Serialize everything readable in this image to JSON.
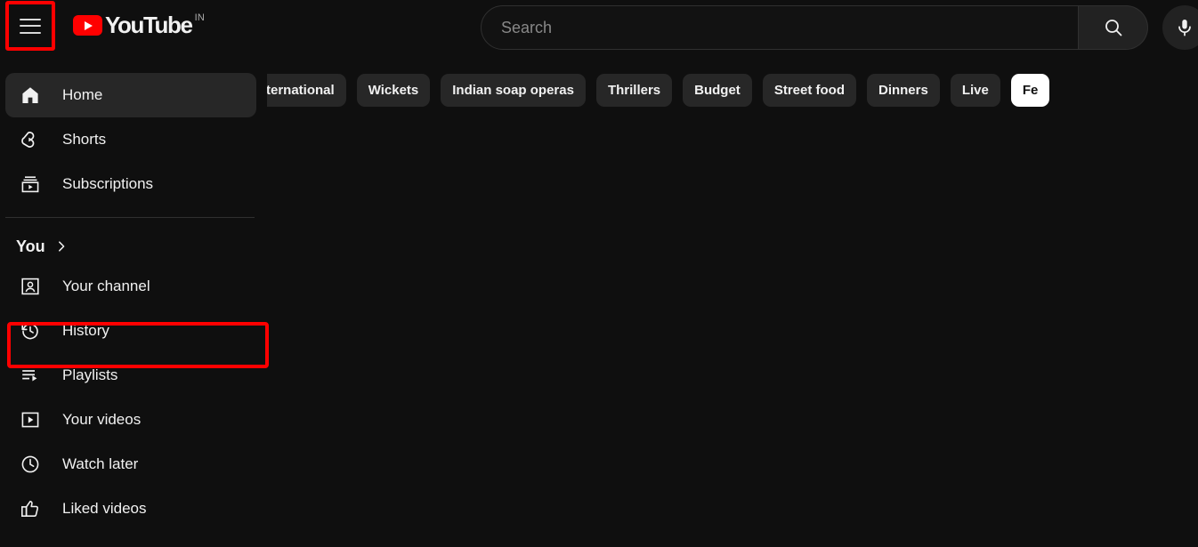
{
  "header": {
    "menu_button": "Guide menu",
    "logo_text": "YouTube",
    "logo_country": "IN",
    "search": {
      "placeholder": "Search",
      "value": "",
      "search_button": "Search",
      "voice_button": "Search with your voice"
    }
  },
  "sidebar": {
    "primary_items": [
      {
        "label": "Home",
        "icon": "home-icon",
        "active": true
      },
      {
        "label": "Shorts",
        "icon": "shorts-icon",
        "active": false
      },
      {
        "label": "Subscriptions",
        "icon": "subscriptions-icon",
        "active": false
      }
    ],
    "you_section": {
      "label": "You",
      "chevron": "chevron-right-icon",
      "items": [
        {
          "label": "Your channel",
          "icon": "your-channel-icon",
          "highlighted": false
        },
        {
          "label": "History",
          "icon": "history-icon",
          "highlighted": true
        },
        {
          "label": "Playlists",
          "icon": "playlists-icon",
          "highlighted": false
        },
        {
          "label": "Your videos",
          "icon": "your-videos-icon",
          "highlighted": false
        },
        {
          "label": "Watch later",
          "icon": "watch-later-icon",
          "highlighted": false
        },
        {
          "label": "Liked videos",
          "icon": "liked-videos-icon",
          "highlighted": false
        }
      ]
    }
  },
  "chips": {
    "scroll_left_icon": "chevron-left-icon",
    "items": [
      {
        "label": "ternational",
        "selected": false,
        "clipped": true
      },
      {
        "label": "Wickets",
        "selected": false
      },
      {
        "label": "Indian soap operas",
        "selected": false
      },
      {
        "label": "Thrillers",
        "selected": false
      },
      {
        "label": "Budget",
        "selected": false
      },
      {
        "label": "Street food",
        "selected": false
      },
      {
        "label": "Dinners",
        "selected": false
      },
      {
        "label": "Live",
        "selected": false
      },
      {
        "label": "Fe",
        "selected": true,
        "clipped": true
      }
    ]
  },
  "annotations": [
    {
      "target": "menu-button",
      "color": "#ff0000"
    },
    {
      "target": "sidebar-item-history",
      "color": "#ff0000"
    }
  ],
  "colors": {
    "background": "#0f0f0f",
    "surface": "#272727",
    "brand_red": "#ff0000",
    "text_primary": "#f1f1f1",
    "text_secondary": "#aaaaaa",
    "annotation": "#ff0000"
  }
}
